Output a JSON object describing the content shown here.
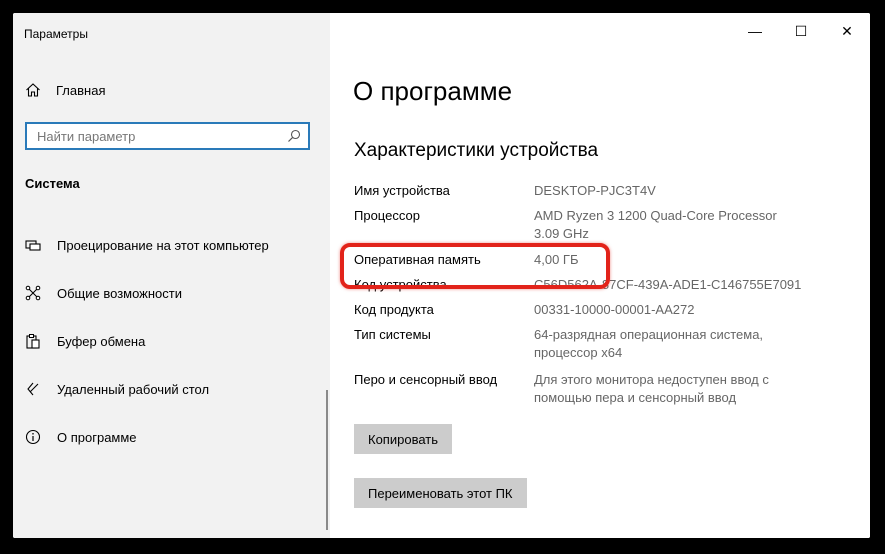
{
  "window": {
    "title": "Параметры",
    "controls": {
      "minimize": "—",
      "maximize": "☐",
      "close": "✕"
    }
  },
  "sidebar": {
    "home_label": "Главная",
    "search": {
      "placeholder": "Найти параметр",
      "value": ""
    },
    "section_label": "Система",
    "items": [
      {
        "label": "Проецирование на этот компьютер",
        "icon": "projector-icon"
      },
      {
        "label": "Общие возможности",
        "icon": "shared-experiences-icon"
      },
      {
        "label": "Буфер обмена",
        "icon": "clipboard-icon"
      },
      {
        "label": "Удаленный рабочий стол",
        "icon": "remote-desktop-icon"
      },
      {
        "label": "О программе",
        "icon": "info-icon"
      }
    ]
  },
  "main": {
    "title": "О программе",
    "device_specs_title": "Характеристики устройства",
    "specs": [
      {
        "label": "Имя устройства",
        "value": "DESKTOP-PJC3T4V"
      },
      {
        "label": "Процессор",
        "value": "AMD Ryzen 3 1200 Quad-Core Processor 3.09 GHz"
      },
      {
        "label": "Оперативная память",
        "value": "4,00 ГБ"
      },
      {
        "label": "Код устройства",
        "value": "C56D562A-87CF-439A-ADE1-C146755E7091"
      },
      {
        "label": "Код продукта",
        "value": "00331-10000-00001-AA272"
      },
      {
        "label": "Тип системы",
        "value": "64-разрядная операционная система, процессор x64"
      },
      {
        "label": "Перо и сенсорный ввод",
        "value": "Для этого монитора недоступен ввод с помощью пера и сенсорный ввод"
      }
    ],
    "copy_button": "Копировать",
    "rename_button": "Переименовать этот ПК"
  },
  "colors": {
    "highlight": "#e2231a",
    "search_border": "#2a7ab9",
    "sidebar_bg": "#f2f2f2",
    "button_bg": "#cccccc"
  }
}
